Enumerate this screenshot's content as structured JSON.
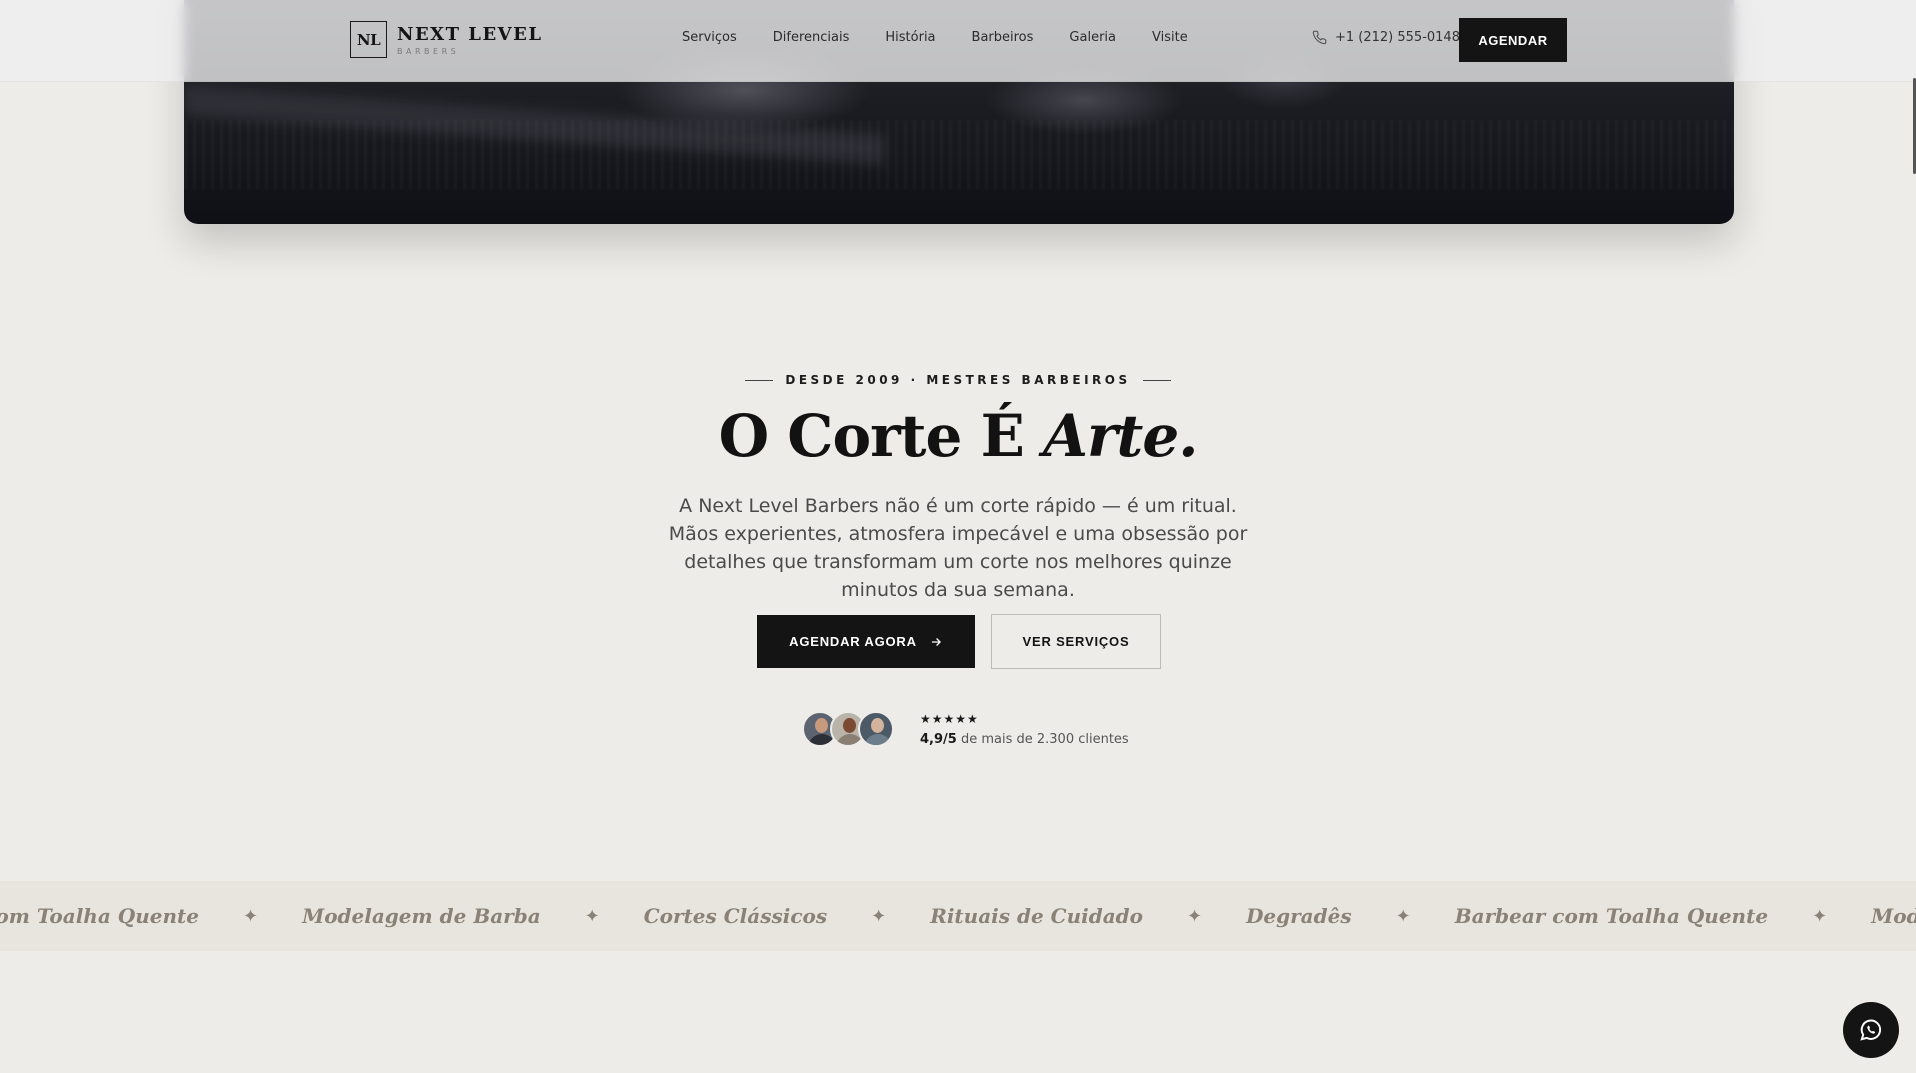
{
  "brand": {
    "initials": "NL",
    "name": "NEXT LEVEL",
    "sub": "BARBERS"
  },
  "nav": [
    "Serviços",
    "Diferenciais",
    "História",
    "Barbeiros",
    "Galeria",
    "Visite"
  ],
  "header": {
    "phone": "+1 (212) 555-0148",
    "book_label": "AGENDAR"
  },
  "hero": {
    "eyebrow": "DESDE 2009 · MESTRES BARBEIROS",
    "title_main": "O Corte É",
    "title_italic": "Arte.",
    "lead": "A Next Level Barbers não é um corte rápido — é um ritual. Mãos experientes, atmosfera impecável e uma obsessão por detalhes que transformam um corte nos melhores quinze minutos da sua semana.",
    "cta_primary": "AGENDAR AGORA",
    "cta_secondary": "VER SERVIÇOS"
  },
  "rating": {
    "stars": "★★★★★",
    "score": "4,9/5",
    "text": "de mais de 2.300 clientes"
  },
  "marquee": [
    "ear com Toalha Quente",
    "Modelagem de Barba",
    "Cortes Clássicos",
    "Rituais de Cuidado",
    "Degradês",
    "Barbear com Toalha Quente",
    "Modelagem de Barba"
  ],
  "icons": {
    "phone": "phone-icon",
    "arrow": "arrow-right-icon",
    "star": "sparkle-icon",
    "whatsapp": "whatsapp-icon"
  },
  "colors": {
    "accent": "#141414",
    "background": "#eeece8",
    "marquee_text": "#8b8277"
  }
}
